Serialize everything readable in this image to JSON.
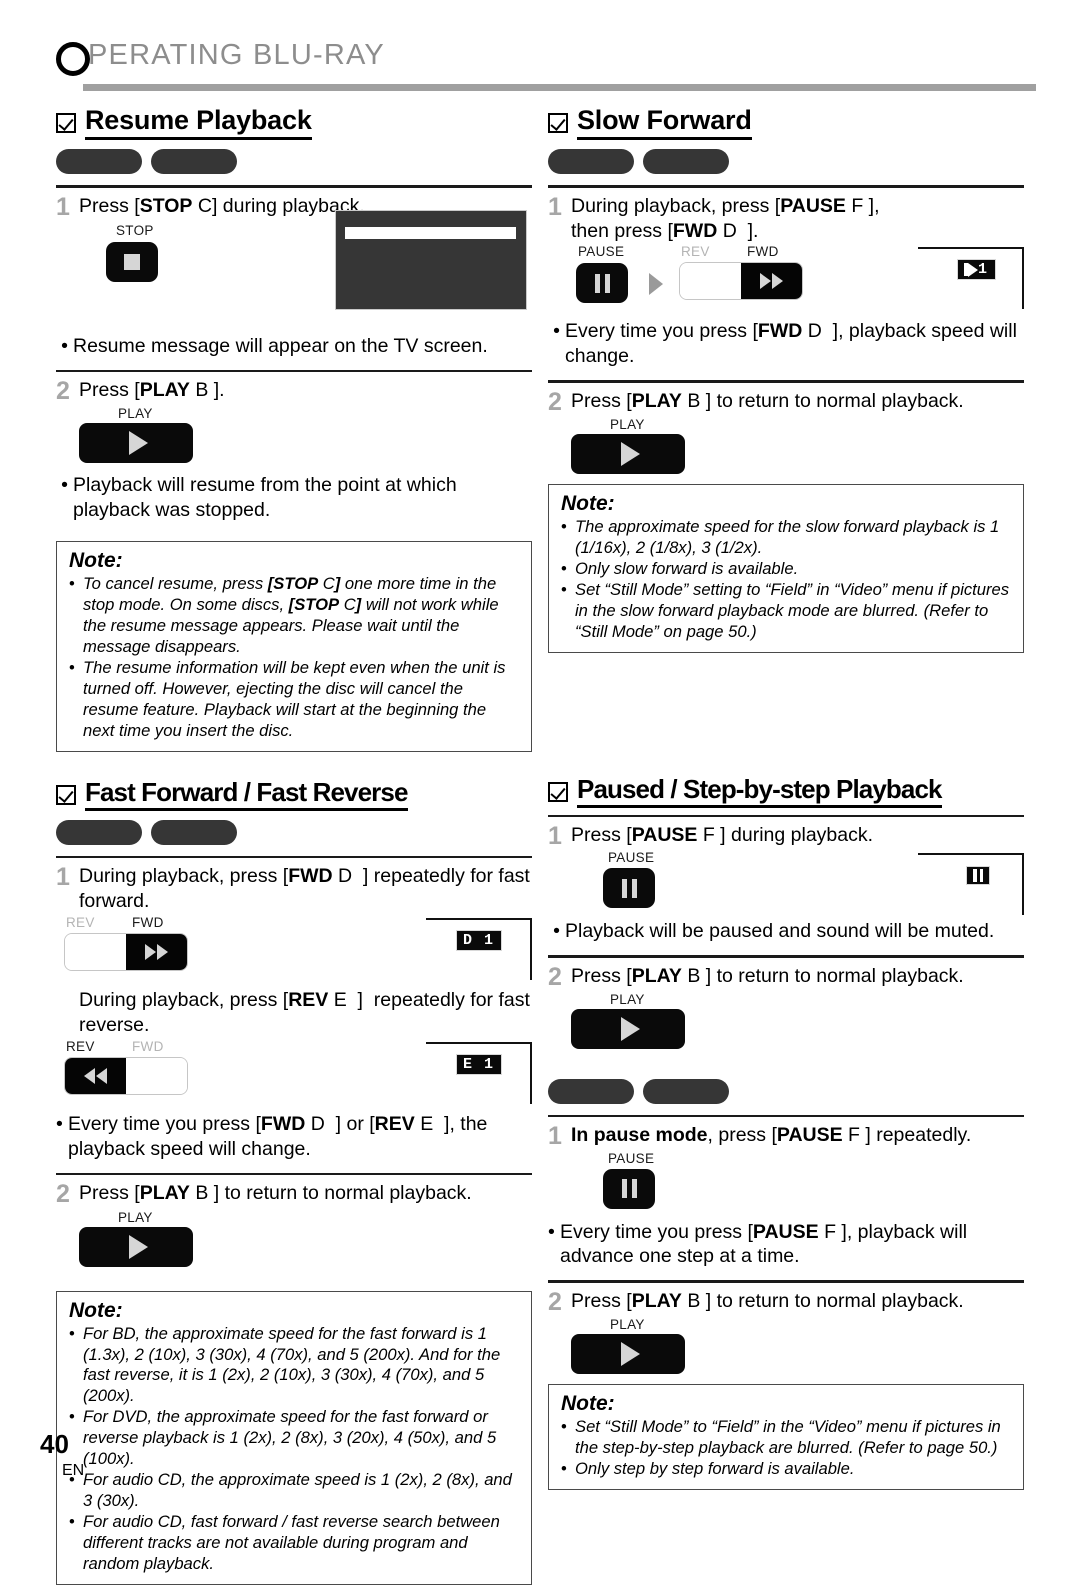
{
  "running_head": {
    "text": "OPERATING BLU-RAY",
    "first_letter": "O",
    "rest": "PERATING  BLU-RAY"
  },
  "page_footer": {
    "number": "40",
    "language": "EN"
  },
  "note_label": "Note:",
  "sections": {
    "resume_playback": {
      "title": "Resume Playback",
      "steps": [
        {
          "num": "1",
          "text_parts": [
            "Press [",
            "STOP",
            " C",
            "] during playback."
          ],
          "key_label": "STOP",
          "bullet": "Resume message will appear on the TV screen."
        },
        {
          "num": "2",
          "text_parts": [
            "Press [",
            "PLAY",
            " B",
            " ]."
          ],
          "key_label": "PLAY",
          "bullet_line1": "Playback will resume from the point at which",
          "bullet_line2": "playback was stopped."
        }
      ],
      "note_items": [
        "To cancel resume, press [STOP C] one more time in the stop mode. On some discs, [STOP C] will not work while the resume message appears. Please wait until the message disappears.",
        "The resume information will be kept even when the unit is turned off. However, ejecting the disc will cancel the resume feature. Playback will start at the beginning the next time you insert the disc."
      ]
    },
    "fast_forward_reverse": {
      "title": "Fast Forward / Fast Reverse",
      "step1_line1": "During playback, press [FWD D  ] repeatedly for fast",
      "step1_line2": "forward.",
      "step1b_line1": "During playback, press [REV E  ]  repeatedly for fast",
      "step1b_line2": "reverse.",
      "key_labels": {
        "rev": "REV",
        "fwd": "FWD"
      },
      "display_fwd": "D   1",
      "display_rev": "E   1",
      "bullet_line1": "Every time you press [FWD D  ] or [REV E  ], the",
      "bullet_line2": "playback speed will change.",
      "step2_text": "Press [PLAY B ] to return to normal playback.",
      "step2_key_label": "PLAY",
      "note_items": [
        "For BD, the approximate speed for the fast forward is 1 (1.3x), 2 (10x), 3 (30x), 4 (70x), and 5 (200x). And for the fast reverse, it is 1 (2x), 2 (10x), 3 (30x), 4 (70x), and 5 (200x).",
        "For DVD, the approximate speed for the fast forward or reverse playback is 1 (2x), 2 (8x), 3 (20x), 4 (50x), and 5 (100x).",
        "For audio CD, the approximate speed is 1 (2x), 2 (8x), and 3 (30x).",
        "For audio CD, fast forward / fast reverse search between different tracks are not available during program and random playback."
      ]
    },
    "slow_forward": {
      "title": "Slow Forward",
      "step1_line1": "During playback, press [PAUSE F ],",
      "step1_line2": "then press [FWD D  ].",
      "key_labels": {
        "pause": "PAUSE",
        "rev": "REV",
        "fwd": "FWD"
      },
      "display_chip": "1",
      "bullet_line1": "Every time you press [FWD D  ], playback speed will",
      "bullet_line2": "change.",
      "step2_text": "Press [PLAY B ] to return to normal playback.",
      "step2_key_label": "PLAY",
      "note_items": [
        "The approximate speed for the slow forward playback is 1 (1/16x), 2 (1/8x), 3 (1/2x).",
        "Only slow forward is available.",
        "Set “Still Mode” setting to “Field” in “Video” menu if pictures in the slow forward playback mode are blurred. (Refer to “Still Mode” on page 50.)"
      ]
    },
    "paused_step_playback": {
      "title": "Paused / Step-by-step Playback",
      "step1_text": "Press [PAUSE F ] during playback.",
      "key_label_pause": "PAUSE",
      "step1_bullet": "Playback will be paused and sound will be muted.",
      "step2_text": "Press [PLAY B ] to return to normal playback.",
      "key_label_play": "PLAY",
      "step3_text_bold": "In pause mode",
      "step3_text_rest": ", press [PAUSE F ] repeatedly.",
      "step3_bullet_line1": "Every time you press [PAUSE F ], playback will",
      "step3_bullet_line2": "advance one step at a time.",
      "step4_text": "Press [PLAY B ] to return to normal playback.",
      "note_items": [
        "Set “Still Mode” to “Field” in the “Video” menu if pictures in the step-by-step playback are blurred. (Refer to page 50.)",
        "Only step by step forward is available."
      ]
    }
  }
}
